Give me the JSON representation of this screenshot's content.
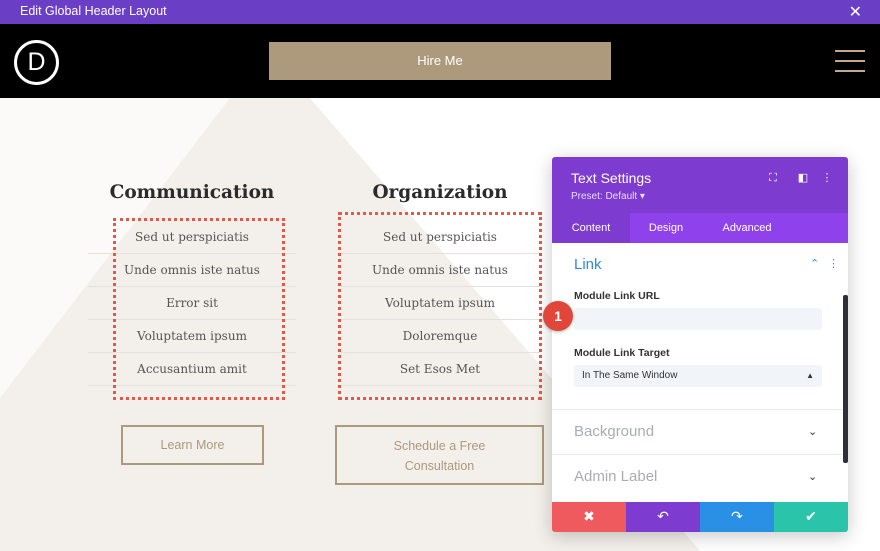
{
  "window": {
    "title": "Edit Global Header Layout",
    "close_icon": "close-icon"
  },
  "header": {
    "logo_letter": "D",
    "hire_button": "Hire Me",
    "menu_icon": "hamburger-menu-icon",
    "accent_color": "#ad9a7c"
  },
  "columns": [
    {
      "title": "Communication",
      "items": [
        "Sed ut perspiciatis",
        "Unde omnis iste natus",
        "Error sit",
        "Voluptatem ipsum",
        "Accusantium amit"
      ],
      "button": "Learn More"
    },
    {
      "title": "Organization",
      "items": [
        "Sed ut perspiciatis",
        "Unde omnis iste natus",
        "Voluptatem ipsum",
        "Doloremque",
        "Set Esos Met"
      ],
      "button_line1": "Schedule a Free",
      "button_line2": "Consultation"
    }
  ],
  "panel": {
    "title": "Text Settings",
    "preset": "Preset: Default ▾",
    "tabs": [
      "Content",
      "Design",
      "Advanced"
    ],
    "active_tab": "Content",
    "link_section": {
      "title": "Link",
      "url_label": "Module Link URL",
      "url_value": "",
      "target_label": "Module Link Target",
      "target_value": "In The Same Window"
    },
    "background_section": "Background",
    "admin_label_section": "Admin Label",
    "footer_colors": {
      "cancel": "#ef5a5f",
      "undo": "#7e3bd0",
      "redo": "#2a90e5",
      "save": "#29c4a9"
    }
  },
  "callout_badge": "1"
}
